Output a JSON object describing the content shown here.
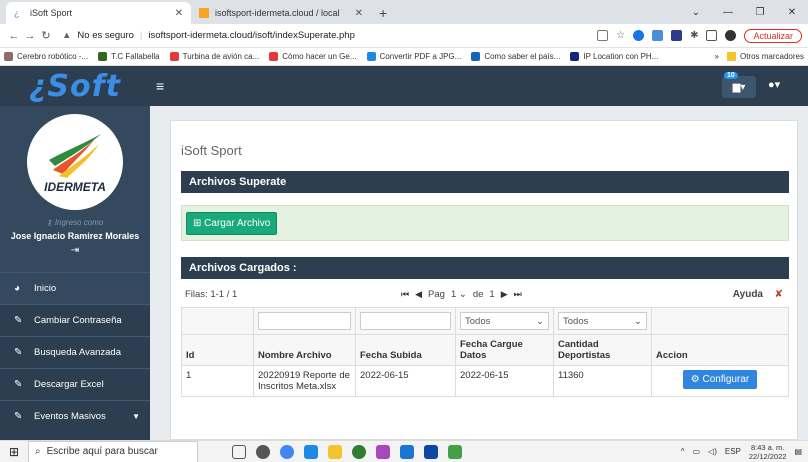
{
  "browser": {
    "tabs": [
      {
        "title": "iSoft Sport",
        "active": true
      },
      {
        "title": "isoftsport-idermeta.cloud / local",
        "active": false
      }
    ],
    "security_label": "No es seguro",
    "url": "isoftsport-idermeta.cloud/isoft/indexSuperate.php",
    "update_label": "Actualizar",
    "bookmarks": [
      "Cerebro robótico -...",
      "T.C Fallabella",
      "Turbina de avión ca...",
      "Cómo hacer un Ge...",
      "Convertir PDF a JPG...",
      "Como saber el país...",
      "IP Location con PH..."
    ],
    "bookmarks_more": "»",
    "other_bookmarks": "Otros marcadores"
  },
  "app": {
    "logo_text": "¿Soft",
    "notification_count": "10",
    "colors": {
      "header": "#2c3e50",
      "accent": "#3a8ee6",
      "success": "#1aa97b",
      "primary": "#2e86de"
    }
  },
  "sidebar": {
    "org_name": "IDERMETA",
    "ingreso_label": "Ingreso como",
    "user_name": "Jose Ignacio Ramirez Morales",
    "items": [
      {
        "label": "Inicio",
        "icon": "dashboard-icon"
      },
      {
        "label": "Cambiar Contraseña",
        "icon": "wrench-icon"
      },
      {
        "label": "Busqueda Avanzada",
        "icon": "wrench-icon"
      },
      {
        "label": "Descargar Excel",
        "icon": "wrench-icon"
      },
      {
        "label": "Eventos Masivos",
        "icon": "wrench-icon"
      }
    ]
  },
  "main": {
    "page_title": "iSoft Sport",
    "panel1_title": "Archivos Superate",
    "upload_button": "Cargar Archivo",
    "panel2_title": "Archivos Cargados :",
    "rows_info": "Filas: 1-1 / 1",
    "pager": {
      "label": "Pag",
      "page": "1",
      "of_label": "de",
      "total": "1"
    },
    "help_label": "Ayuda",
    "filters": {
      "fecha_cargue": "Todos",
      "cantidad": "Todos"
    },
    "columns": [
      "Id",
      "Nombre Archivo",
      "Fecha Subida",
      "Fecha Cargue Datos",
      "Cantidad Deportistas",
      "Accion"
    ],
    "rows": [
      {
        "id": "1",
        "nombre": "20220919 Reporte de Inscritos Meta.xlsx",
        "fecha_subida": "2022-06-15",
        "fecha_cargue": "2022-06-15",
        "cantidad": "11360",
        "accion": "Configurar"
      }
    ]
  },
  "taskbar": {
    "search_placeholder": "Escribe aquí para buscar",
    "lang": "ESP",
    "time": "8:43 a. m.",
    "date": "22/12/2022"
  }
}
